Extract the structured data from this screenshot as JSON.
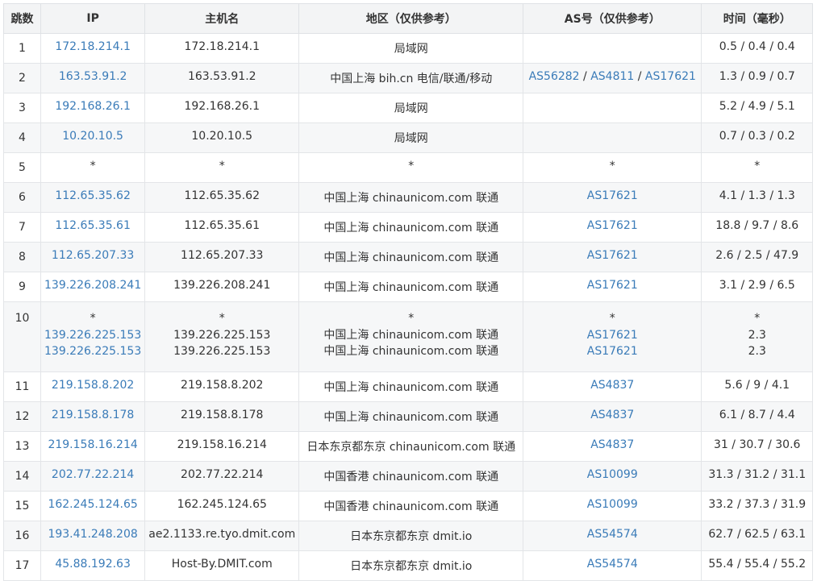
{
  "colors": {
    "link": "#3a7bb8",
    "header_bg": "#f3f4f5",
    "border": "#e3e5e8",
    "text": "#333333"
  },
  "headers": [
    "跳数",
    "IP",
    "主机名",
    "地区（仅供参考）",
    "AS号（仅供参考）",
    "时间（毫秒）"
  ],
  "rows": [
    {
      "hop": "1",
      "ip": [
        "172.18.214.1"
      ],
      "host": [
        "172.18.214.1"
      ],
      "region": [
        "局域网"
      ],
      "as": [
        []
      ],
      "time": [
        "0.5 / 0.4 / 0.4"
      ]
    },
    {
      "hop": "2",
      "ip": [
        "163.53.91.2"
      ],
      "host": [
        "163.53.91.2"
      ],
      "region": [
        "中国上海 bih.cn 电信/联通/移动"
      ],
      "as": [
        [
          "AS56282",
          "AS4811",
          "AS17621"
        ]
      ],
      "time": [
        "1.3 / 0.9 / 0.7"
      ]
    },
    {
      "hop": "3",
      "ip": [
        "192.168.26.1"
      ],
      "host": [
        "192.168.26.1"
      ],
      "region": [
        "局域网"
      ],
      "as": [
        []
      ],
      "time": [
        "5.2 / 4.9 / 5.1"
      ]
    },
    {
      "hop": "4",
      "ip": [
        "10.20.10.5"
      ],
      "host": [
        "10.20.10.5"
      ],
      "region": [
        "局域网"
      ],
      "as": [
        []
      ],
      "time": [
        "0.7 / 0.3 / 0.2"
      ]
    },
    {
      "hop": "5",
      "ip": [
        "*"
      ],
      "host": [
        "*"
      ],
      "region": [
        "*"
      ],
      "as": [
        [
          "*"
        ]
      ],
      "time": [
        "*"
      ]
    },
    {
      "hop": "6",
      "ip": [
        "112.65.35.62"
      ],
      "host": [
        "112.65.35.62"
      ],
      "region": [
        "中国上海 chinaunicom.com 联通"
      ],
      "as": [
        [
          "AS17621"
        ]
      ],
      "time": [
        "4.1 / 1.3 / 1.3"
      ]
    },
    {
      "hop": "7",
      "ip": [
        "112.65.35.61"
      ],
      "host": [
        "112.65.35.61"
      ],
      "region": [
        "中国上海 chinaunicom.com 联通"
      ],
      "as": [
        [
          "AS17621"
        ]
      ],
      "time": [
        "18.8 / 9.7 / 8.6"
      ]
    },
    {
      "hop": "8",
      "ip": [
        "112.65.207.33"
      ],
      "host": [
        "112.65.207.33"
      ],
      "region": [
        "中国上海 chinaunicom.com 联通"
      ],
      "as": [
        [
          "AS17621"
        ]
      ],
      "time": [
        "2.6 / 2.5 / 47.9"
      ]
    },
    {
      "hop": "9",
      "ip": [
        "139.226.208.241"
      ],
      "host": [
        "139.226.208.241"
      ],
      "region": [
        "中国上海 chinaunicom.com 联通"
      ],
      "as": [
        [
          "AS17621"
        ]
      ],
      "time": [
        "3.1 / 2.9 / 6.5"
      ]
    },
    {
      "hop": "10",
      "ip": [
        "*",
        "139.226.225.153",
        "139.226.225.153"
      ],
      "host": [
        "*",
        "139.226.225.153",
        "139.226.225.153"
      ],
      "region": [
        "*",
        "中国上海 chinaunicom.com 联通",
        "中国上海 chinaunicom.com 联通"
      ],
      "as": [
        [
          "*"
        ],
        [
          "AS17621"
        ],
        [
          "AS17621"
        ]
      ],
      "time": [
        "*",
        "2.3",
        "2.3"
      ]
    },
    {
      "hop": "11",
      "ip": [
        "219.158.8.202"
      ],
      "host": [
        "219.158.8.202"
      ],
      "region": [
        "中国上海 chinaunicom.com 联通"
      ],
      "as": [
        [
          "AS4837"
        ]
      ],
      "time": [
        "5.6 / 9 / 4.1"
      ]
    },
    {
      "hop": "12",
      "ip": [
        "219.158.8.178"
      ],
      "host": [
        "219.158.8.178"
      ],
      "region": [
        "中国上海 chinaunicom.com 联通"
      ],
      "as": [
        [
          "AS4837"
        ]
      ],
      "time": [
        "6.1 / 8.7 / 4.4"
      ]
    },
    {
      "hop": "13",
      "ip": [
        "219.158.16.214"
      ],
      "host": [
        "219.158.16.214"
      ],
      "region": [
        "日本东京都东京 chinaunicom.com 联通"
      ],
      "as": [
        [
          "AS4837"
        ]
      ],
      "time": [
        "31 / 30.7 / 30.6"
      ]
    },
    {
      "hop": "14",
      "ip": [
        "202.77.22.214"
      ],
      "host": [
        "202.77.22.214"
      ],
      "region": [
        "中国香港 chinaunicom.com 联通"
      ],
      "as": [
        [
          "AS10099"
        ]
      ],
      "time": [
        "31.3 / 31.2 / 31.1"
      ]
    },
    {
      "hop": "15",
      "ip": [
        "162.245.124.65"
      ],
      "host": [
        "162.245.124.65"
      ],
      "region": [
        "中国香港 chinaunicom.com 联通"
      ],
      "as": [
        [
          "AS10099"
        ]
      ],
      "time": [
        "33.2 / 37.3 / 31.9"
      ]
    },
    {
      "hop": "16",
      "ip": [
        "193.41.248.208"
      ],
      "host": [
        "ae2.1133.re.tyo.dmit.com"
      ],
      "region": [
        "日本东京都东京 dmit.io"
      ],
      "as": [
        [
          "AS54574"
        ]
      ],
      "time": [
        "62.7 / 62.5 / 63.1"
      ]
    },
    {
      "hop": "17",
      "ip": [
        "45.88.192.63"
      ],
      "host": [
        "Host-By.DMIT.com"
      ],
      "region": [
        "日本东京都东京 dmit.io"
      ],
      "as": [
        [
          "AS54574"
        ]
      ],
      "time": [
        "55.4 / 55.4 / 55.2"
      ]
    }
  ]
}
